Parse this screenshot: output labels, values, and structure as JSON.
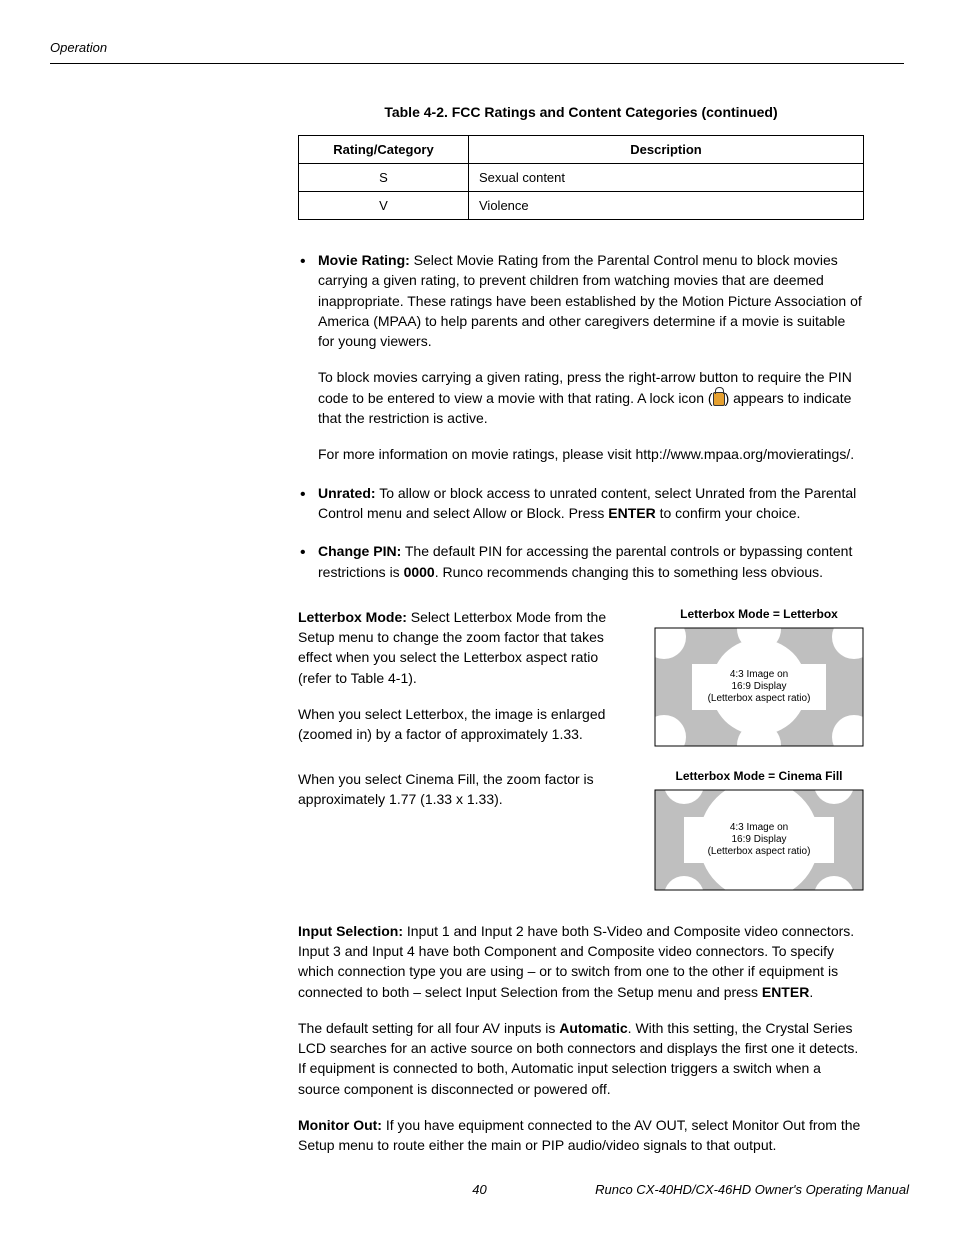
{
  "header": {
    "section": "Operation"
  },
  "tableCaption": "Table 4-2. FCC Ratings and Content Categories (continued)",
  "table": {
    "headers": {
      "col1": "Rating/Category",
      "col2": "Description"
    },
    "rows": [
      {
        "rating": "S",
        "desc": "Sexual content"
      },
      {
        "rating": "V",
        "desc": "Violence"
      }
    ]
  },
  "bullets": {
    "movieRating": {
      "label": "Movie Rating:",
      "p1": " Select Movie Rating from the Parental Control menu to block movies carrying a given rating, to prevent children from watching movies that are deemed inappropriate. These ratings have been established by the Motion Picture Association of America (MPAA) to help parents and other caregivers determine if a movie is suitable for young viewers.",
      "p2a": "To block movies carrying a given rating, press the right-arrow button to require the PIN code to be entered to view a movie with that rating. A lock icon (",
      "p2b": ") appears to indicate that the restriction is active.",
      "p3": "For more information on movie ratings, please visit http://www.mpaa.org/movieratings/."
    },
    "unrated": {
      "label": "Unrated:",
      "t1": " To allow or block access to unrated content, select Unrated from the Parental Control menu and select Allow or Block. Press ",
      "enter": "ENTER",
      "t2": " to confirm your choice."
    },
    "changePin": {
      "label": "Change PIN:",
      "t1": " The default PIN for accessing the parental controls or bypassing content restrictions is ",
      "pin": "0000",
      "t2": ". Runco recommends changing this to something less obvious."
    }
  },
  "letterbox": {
    "introLabel": "Letterbox Mode:",
    "introText": " Select Letterbox Mode from the Setup menu to change the zoom factor that takes effect when you select the Letterbox aspect ratio (refer to Table 4-1).",
    "p2": "When you select Letterbox, the image is enlarged (zoomed in) by a factor of approximately 1.33.",
    "p3": "When you select Cinema Fill, the zoom factor is approximately 1.77 (1.33 x 1.33).",
    "fig1": {
      "title": "Letterbox Mode = Letterbox",
      "l1": "4:3 Image on",
      "l2": "16:9 Display",
      "l3": "(Letterbox aspect ratio)"
    },
    "fig2": {
      "title": "Letterbox Mode = Cinema Fill",
      "l1": "4:3 Image on",
      "l2": "16:9 Display",
      "l3": "(Letterbox aspect ratio)"
    }
  },
  "inputSelection": {
    "label": "Input Selection:",
    "t1": " Input 1 and Input 2 have both S-Video and Composite video connectors. Input 3 and Input 4 have both Component and Composite video connectors. To specify which connection type you are using – or to switch from one to the other if equipment is connected to both – select Input Selection from the Setup menu and press ",
    "enter": "ENTER",
    "t2": ".",
    "p2a": "The default setting for all four AV inputs is ",
    "auto": "Automatic",
    "p2b": ". With this setting, the Crystal Series LCD searches for an active source on both connectors and displays the first one it detects. If equipment is connected to both, Automatic input selection triggers a switch when a source component is disconnected or powered off."
  },
  "monitorOut": {
    "label": "Monitor Out:",
    "text": " If you have equipment connected to the AV OUT, select Monitor Out from the Setup menu to route either the main or PIP audio/video signals to that output."
  },
  "footer": {
    "page": "40",
    "title": "Runco CX-40HD/CX-46HD Owner's Operating Manual"
  }
}
